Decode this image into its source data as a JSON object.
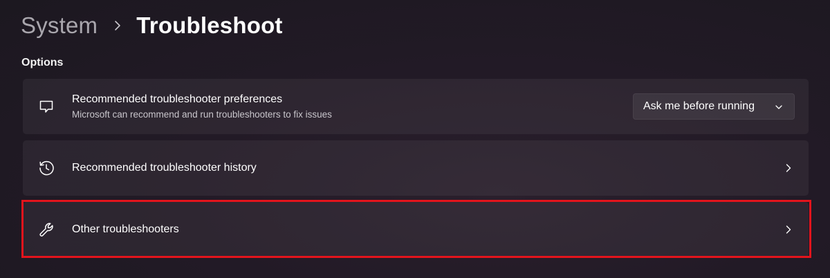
{
  "breadcrumb": {
    "parent": "System",
    "current": "Troubleshoot"
  },
  "section": {
    "title": "Options"
  },
  "items": [
    {
      "title": "Recommended troubleshooter preferences",
      "description": "Microsoft can recommend and run troubleshooters to fix issues",
      "icon": "chat-bubble-icon",
      "control": {
        "type": "dropdown",
        "selected": "Ask me before running"
      }
    },
    {
      "title": "Recommended troubleshooter history",
      "icon": "history-icon",
      "control": {
        "type": "chevron-right"
      }
    },
    {
      "title": "Other troubleshooters",
      "icon": "wrench-icon",
      "control": {
        "type": "chevron-right"
      },
      "highlighted": true
    }
  ],
  "colors": {
    "highlight": "#e3141c",
    "background": "#221a26",
    "card": "#2c2530"
  }
}
